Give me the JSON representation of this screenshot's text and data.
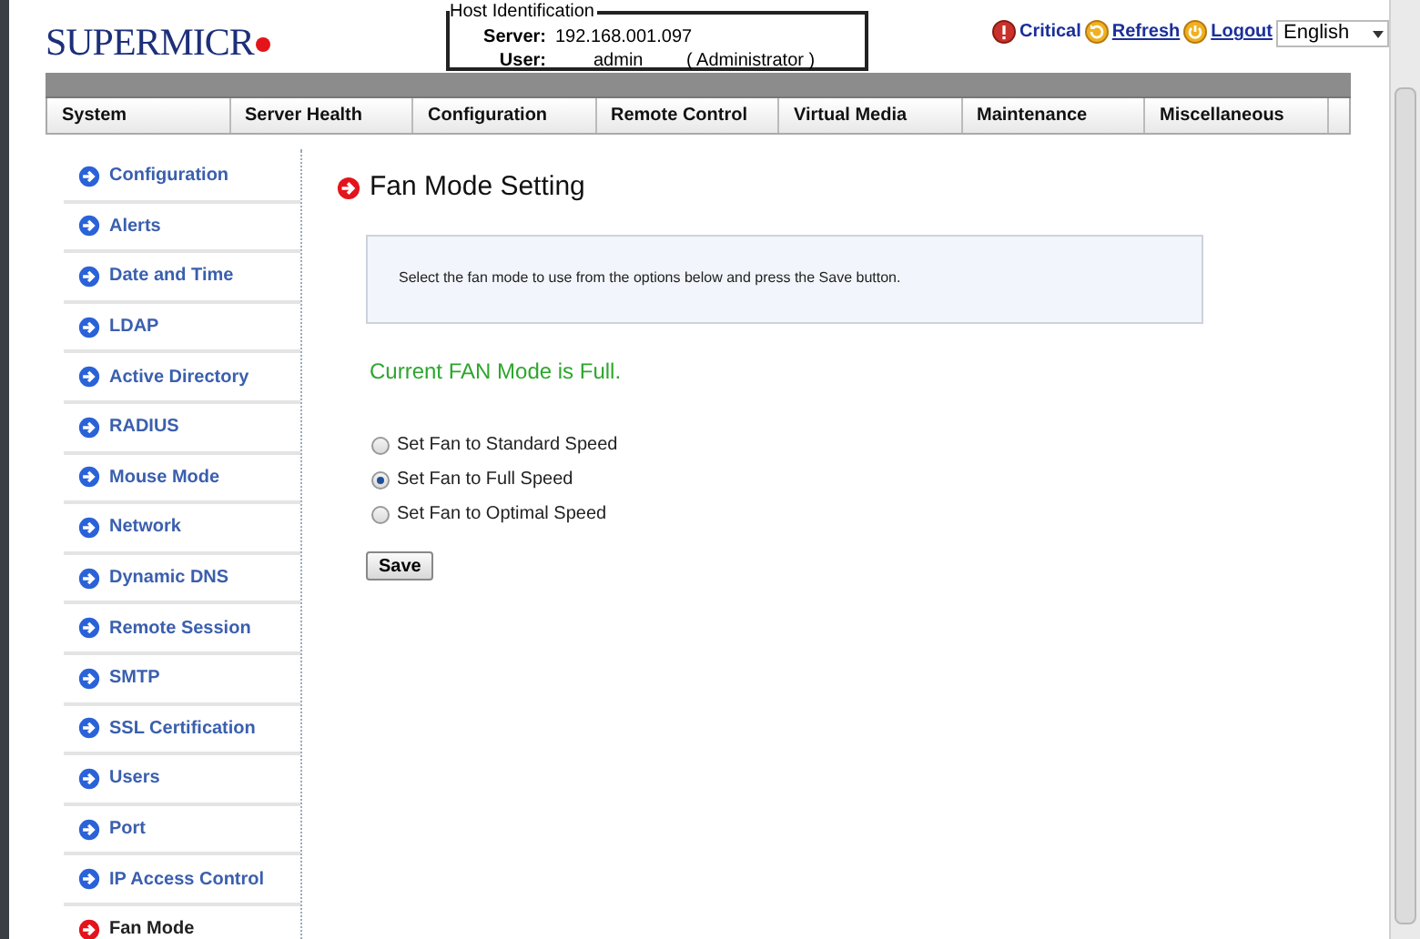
{
  "logo": {
    "text": "SUPERMICR"
  },
  "host": {
    "title": "Host Identification",
    "fields": [
      {
        "label": "Server:",
        "value": "192.168.001.097"
      },
      {
        "label": "User:",
        "value": "admin",
        "role": "( Administrator )"
      }
    ]
  },
  "header_links": [
    {
      "label": "Critical",
      "kind": "alert"
    },
    {
      "label": "Refresh",
      "kind": "refresh"
    },
    {
      "label": "Logout",
      "kind": "logout"
    }
  ],
  "language": {
    "value": "English"
  },
  "menu": [
    "System",
    "Server Health",
    "Configuration",
    "Remote Control",
    "Virtual Media",
    "Maintenance",
    "Miscellaneous"
  ],
  "sidebar": {
    "items": [
      {
        "label": "Configuration",
        "selected": false
      },
      {
        "label": "Alerts",
        "selected": false
      },
      {
        "label": "Date and Time",
        "selected": false
      },
      {
        "label": "LDAP",
        "selected": false
      },
      {
        "label": "Active Directory",
        "selected": false
      },
      {
        "label": "RADIUS",
        "selected": false
      },
      {
        "label": "Mouse Mode",
        "selected": false
      },
      {
        "label": "Network",
        "selected": false
      },
      {
        "label": "Dynamic DNS",
        "selected": false
      },
      {
        "label": "Remote Session",
        "selected": false
      },
      {
        "label": "SMTP",
        "selected": false
      },
      {
        "label": "SSL Certification",
        "selected": false
      },
      {
        "label": "Users",
        "selected": false
      },
      {
        "label": "Port",
        "selected": false
      },
      {
        "label": "IP Access Control",
        "selected": false
      },
      {
        "label": "Fan Mode",
        "selected": true
      }
    ]
  },
  "content": {
    "title": "Fan Mode Setting",
    "instructions": "Select the fan mode to use from the options below and press the Save button.",
    "status": "Current FAN Mode is Full.",
    "options": [
      {
        "label": "Set Fan to Standard Speed",
        "selected": false
      },
      {
        "label": "Set Fan to Full Speed",
        "selected": true
      },
      {
        "label": "Set Fan to Optimal Speed",
        "selected": false
      }
    ],
    "button": "Save"
  }
}
